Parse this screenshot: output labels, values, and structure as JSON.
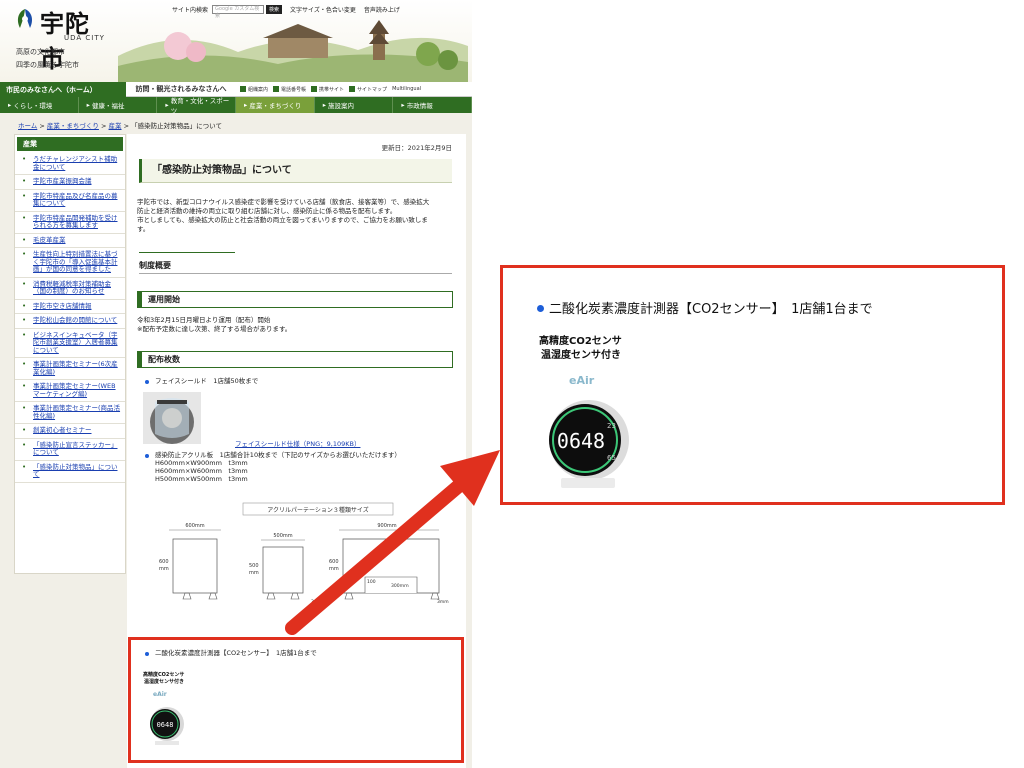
{
  "header": {
    "logo_text": "宇陀市",
    "logo_sub": "UDA CITY",
    "tagline_1": "高原の文化都市",
    "tagline_2": "四季の風薫る宇陀市",
    "search_label": "サイト内検索",
    "search_placeholder": "Google カスタム検索",
    "search_button": "検索",
    "font_color_link": "文字サイズ・色合い変更",
    "read_aloud": "音声読み上げ"
  },
  "nav_top": {
    "residents": "市民のみなさんへ（ホーム）",
    "visitors": "訪問・観光されるみなさんへ",
    "links": [
      "組織案内",
      "電話番号帳",
      "携帯サイト",
      "サイトマップ",
      "Multilingual"
    ]
  },
  "nav_main": [
    "くらし・環境",
    "健康・福祉",
    "教育・文化・スポーツ",
    "産業・まちづくり",
    "施設案内",
    "市政情報"
  ],
  "breadcrumb": {
    "home": "ホーム",
    "sep": ">",
    "cat": "産業・まちづくり",
    "sub": "産業",
    "current": "「感染防止対策物品」について"
  },
  "sidebar": {
    "heading": "産業",
    "items": [
      "うだチャレンジアシスト補助金について",
      "宇陀市産業振興会議",
      "宇陀市特産品及び名産品の募集について",
      "宇陀市特産品開発補助を受けられる方を募集します",
      "毛皮革産業",
      "生産性向上特別措置法に基づく宇陀市の「導入促進基本計画」が国の同意を得ました",
      "消費税軽減税率対策補助金（国の制度）のお知らせ",
      "宇陀市空き店舗情報",
      "宇陀松山会館の開館について",
      "ビジネスインキュベータ（宇陀市創業支援室）入居者募集について",
      "事業計画策定セミナー(6次産業化編)",
      "事業計画策定セミナー(WEBマーケティング編)",
      "事業計画策定セミナー(商品活性化編)",
      "創業初心者セミナー",
      "「感染防止宣言ステッカー」について",
      "「感染防止対策物品」について"
    ]
  },
  "main": {
    "updated": "更新日：2021年2月9日",
    "title": "「感染防止対策物品」について",
    "intro_1": "宇陀市では、新型コロナウイルス感染症で影響を受けている店舗（飲食店、接客業等）で、感染拡大",
    "intro_2": "防止と経済活動の維持の両立に取り組む店舗に対し、感染防止に係る物品を配布します。",
    "intro_3": "市としましても、感染拡大の防止と社会活動の両立を図ってまいりますので、ご協力をお願い致しま",
    "intro_4": "す。",
    "section_overview": "制度概要",
    "section_start": "運用開始",
    "start_text_1": "令和3年2月15日月曜日より運用（配布）開始",
    "start_text_2": "※配布予定数に達し次第、終了する場合があります。",
    "section_count": "配布枚数",
    "item_faceshield": "フェイスシールド　1店舗50枚まで",
    "faceshield_link": "フェイスシールド仕様（PNG：9,109KB）",
    "item_acrylic": "感染防止アクリル板　1店舗合計10枚まで（下記のサイズからお選びいただけます）",
    "acrylic_size_1": "H600mm×W900mm　t3mm",
    "acrylic_size_2": "H600mm×W600mm　t3mm",
    "acrylic_size_3": "H500mm×W500mm　t3mm",
    "diagram_title": "アクリルパーテーション３種類サイズ",
    "dim_600w": "600mm",
    "dim_500w": "500mm",
    "dim_900w": "900mm",
    "dim_600h": "600",
    "dim_500h": "500",
    "dim_mm": "mm",
    "dim_100": "100",
    "dim_300": "300ｍｍ",
    "dim_3mm": "3mm",
    "item_co2": "二酸化炭素濃度計測器【CO2センサー】　1店舗1台まで",
    "co2_label_1": "高精度CO2センサ",
    "co2_label_2": "温湿度センサ付き",
    "co2_brand": "eAir",
    "co2_reading": "0648",
    "co2_side_1": "23",
    "co2_side_2": "65"
  },
  "zoom": {
    "text": "二酸化炭素濃度計測器【CO2センサー】　1店舗1台まで",
    "label_1": "高精度CO2センサ",
    "label_2": "温湿度センサ付き",
    "brand": "eAir",
    "reading": "0648",
    "side_1": "23",
    "side_2": "65"
  },
  "colors": {
    "green": "#2f6d22",
    "callout_red": "#e0301e",
    "link_blue": "#1a3fb0"
  }
}
